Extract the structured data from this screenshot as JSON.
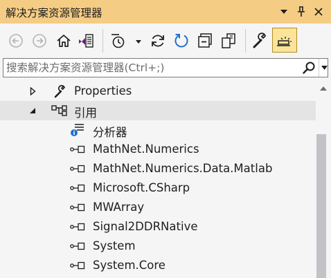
{
  "title": {
    "text": "解决方案资源管理器",
    "pin_glyph": "ᛘ",
    "close_glyph": "✕",
    "bg_color": "#f5cc84"
  },
  "toolbar": {
    "buttons": [
      {
        "name": "back-icon",
        "enabled": false
      },
      {
        "name": "forward-icon",
        "enabled": false
      },
      {
        "name": "home-icon",
        "enabled": true
      },
      {
        "name": "switch-views-icon",
        "enabled": true
      },
      {
        "name": "pending-changes-filter-icon",
        "enabled": true
      },
      {
        "name": "sync-icon",
        "enabled": true
      },
      {
        "name": "refresh-icon",
        "enabled": true
      },
      {
        "name": "collapse-all-icon",
        "enabled": true
      },
      {
        "name": "show-all-files-icon",
        "enabled": true
      },
      {
        "name": "properties-icon",
        "enabled": true
      },
      {
        "name": "preview-selected-icon",
        "enabled": true,
        "active": true
      }
    ]
  },
  "search": {
    "placeholder": "搜索解决方案资源管理器(Ctrl+;)"
  },
  "tree": {
    "items": [
      {
        "label": "Properties",
        "icon": "wrench-icon",
        "expander": "collapsed"
      },
      {
        "label": "引用",
        "icon": "references-icon",
        "expander": "expanded",
        "selected": true
      },
      {
        "label": "分析器",
        "icon": "analyzer-icon"
      },
      {
        "label": "MathNet.Numerics",
        "icon": "assembly-reference-icon"
      },
      {
        "label": "MathNet.Numerics.Data.Matlab",
        "icon": "assembly-reference-icon"
      },
      {
        "label": "Microsoft.CSharp",
        "icon": "assembly-reference-icon"
      },
      {
        "label": "MWArray",
        "icon": "assembly-reference-icon"
      },
      {
        "label": "Signal2DDRNative",
        "icon": "assembly-reference-icon"
      },
      {
        "label": "System",
        "icon": "assembly-reference-icon"
      },
      {
        "label": "System.Core",
        "icon": "assembly-reference-icon"
      }
    ]
  },
  "colors": {
    "title_bar": "#f5cc84",
    "background": "#f5f5f5",
    "selection": "#e4e4e4",
    "accent_blue": "#1e6fd0",
    "vs_purple": "#68217a",
    "active_button": "#fbe49a"
  }
}
